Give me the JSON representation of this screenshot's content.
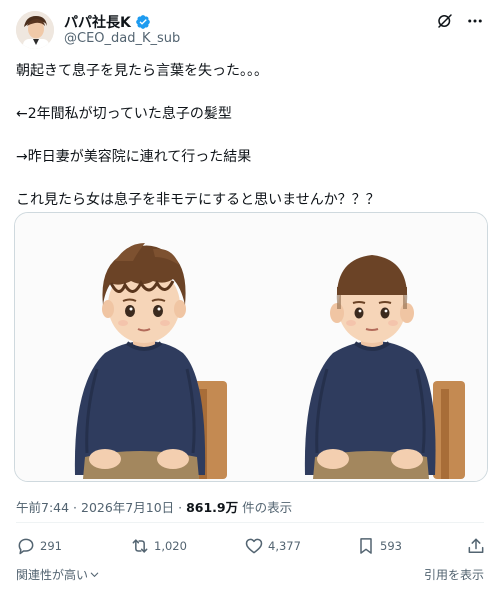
{
  "header": {
    "display_name": "パパ社長K",
    "handle": "@CEO_dad_K_sub",
    "verified": true,
    "verified_color": "#1d9bf0"
  },
  "tweet": {
    "lines": [
      "朝起きて息子を見たら言葉を失った。。。",
      "←2年間私が切っていた息子の髪型",
      "→昨日妻が美容院に連れて行った結果",
      "これ見たら女は息子を非モテにすると思いませんか？？？"
    ]
  },
  "meta": {
    "timestamp": "午前7:44 · 2026年7月10日 · ",
    "views": "861.9万",
    "views_suffix": " 件の表示"
  },
  "actions": {
    "replies": "291",
    "reposts": "1,020",
    "likes": "4,377",
    "bookmarks": "593"
  },
  "footer": {
    "relevance": "関連性が高い",
    "quotes": "引用を表示"
  },
  "icons": {
    "grok": "grok-icon",
    "more": "more-icon",
    "reply": "reply-icon",
    "repost": "repost-icon",
    "like": "heart-icon",
    "bookmark": "bookmark-icon",
    "share": "share-icon",
    "chevron": "chevron-down-icon"
  },
  "colors": {
    "text": "#0f1419",
    "secondary": "#536471",
    "sweater": "#2f3c5e",
    "hair": "#6b4326"
  }
}
